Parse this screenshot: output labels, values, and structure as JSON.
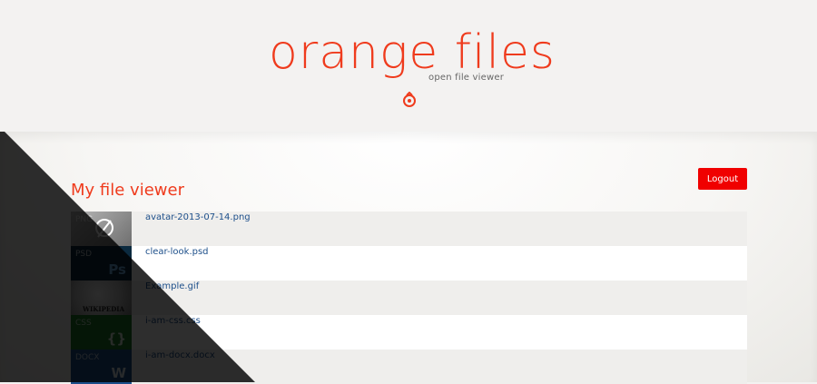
{
  "header": {
    "logo_text": "orange files",
    "tagline": "open file viewer",
    "logo_mark_icon": "orange-logo-mark-icon"
  },
  "main": {
    "title": "My file viewer",
    "logout_label": "Logout"
  },
  "files": [
    {
      "name": "avatar-2013-07-14.png",
      "type": "PNG",
      "thumb_icon": "image-thumbnail-icon",
      "thumb_color": "#8a8a8a"
    },
    {
      "name": "clear-look.psd",
      "type": "PSD",
      "thumb_icon": "photoshop-icon",
      "glyph": "Ps",
      "thumb_color": "#0b2a3f"
    },
    {
      "name": "Example.gif",
      "type": "GIF",
      "thumb_icon": "wikipedia-globe-icon",
      "glyph": "WIKIPEDIA",
      "thumb_color": "#c9c9c9"
    },
    {
      "name": "i-am-css.css",
      "type": "CSS",
      "thumb_icon": "css-braces-icon",
      "glyph": "{}",
      "thumb_color": "#1e7c2b"
    },
    {
      "name": "i-am-docx.docx",
      "type": "DOCX",
      "thumb_icon": "word-document-icon",
      "glyph": "W",
      "thumb_color": "#1d4f8a"
    }
  ],
  "colors": {
    "accent": "#ef3b1d",
    "logout": "#f00000",
    "link": "#1d4f8a"
  }
}
